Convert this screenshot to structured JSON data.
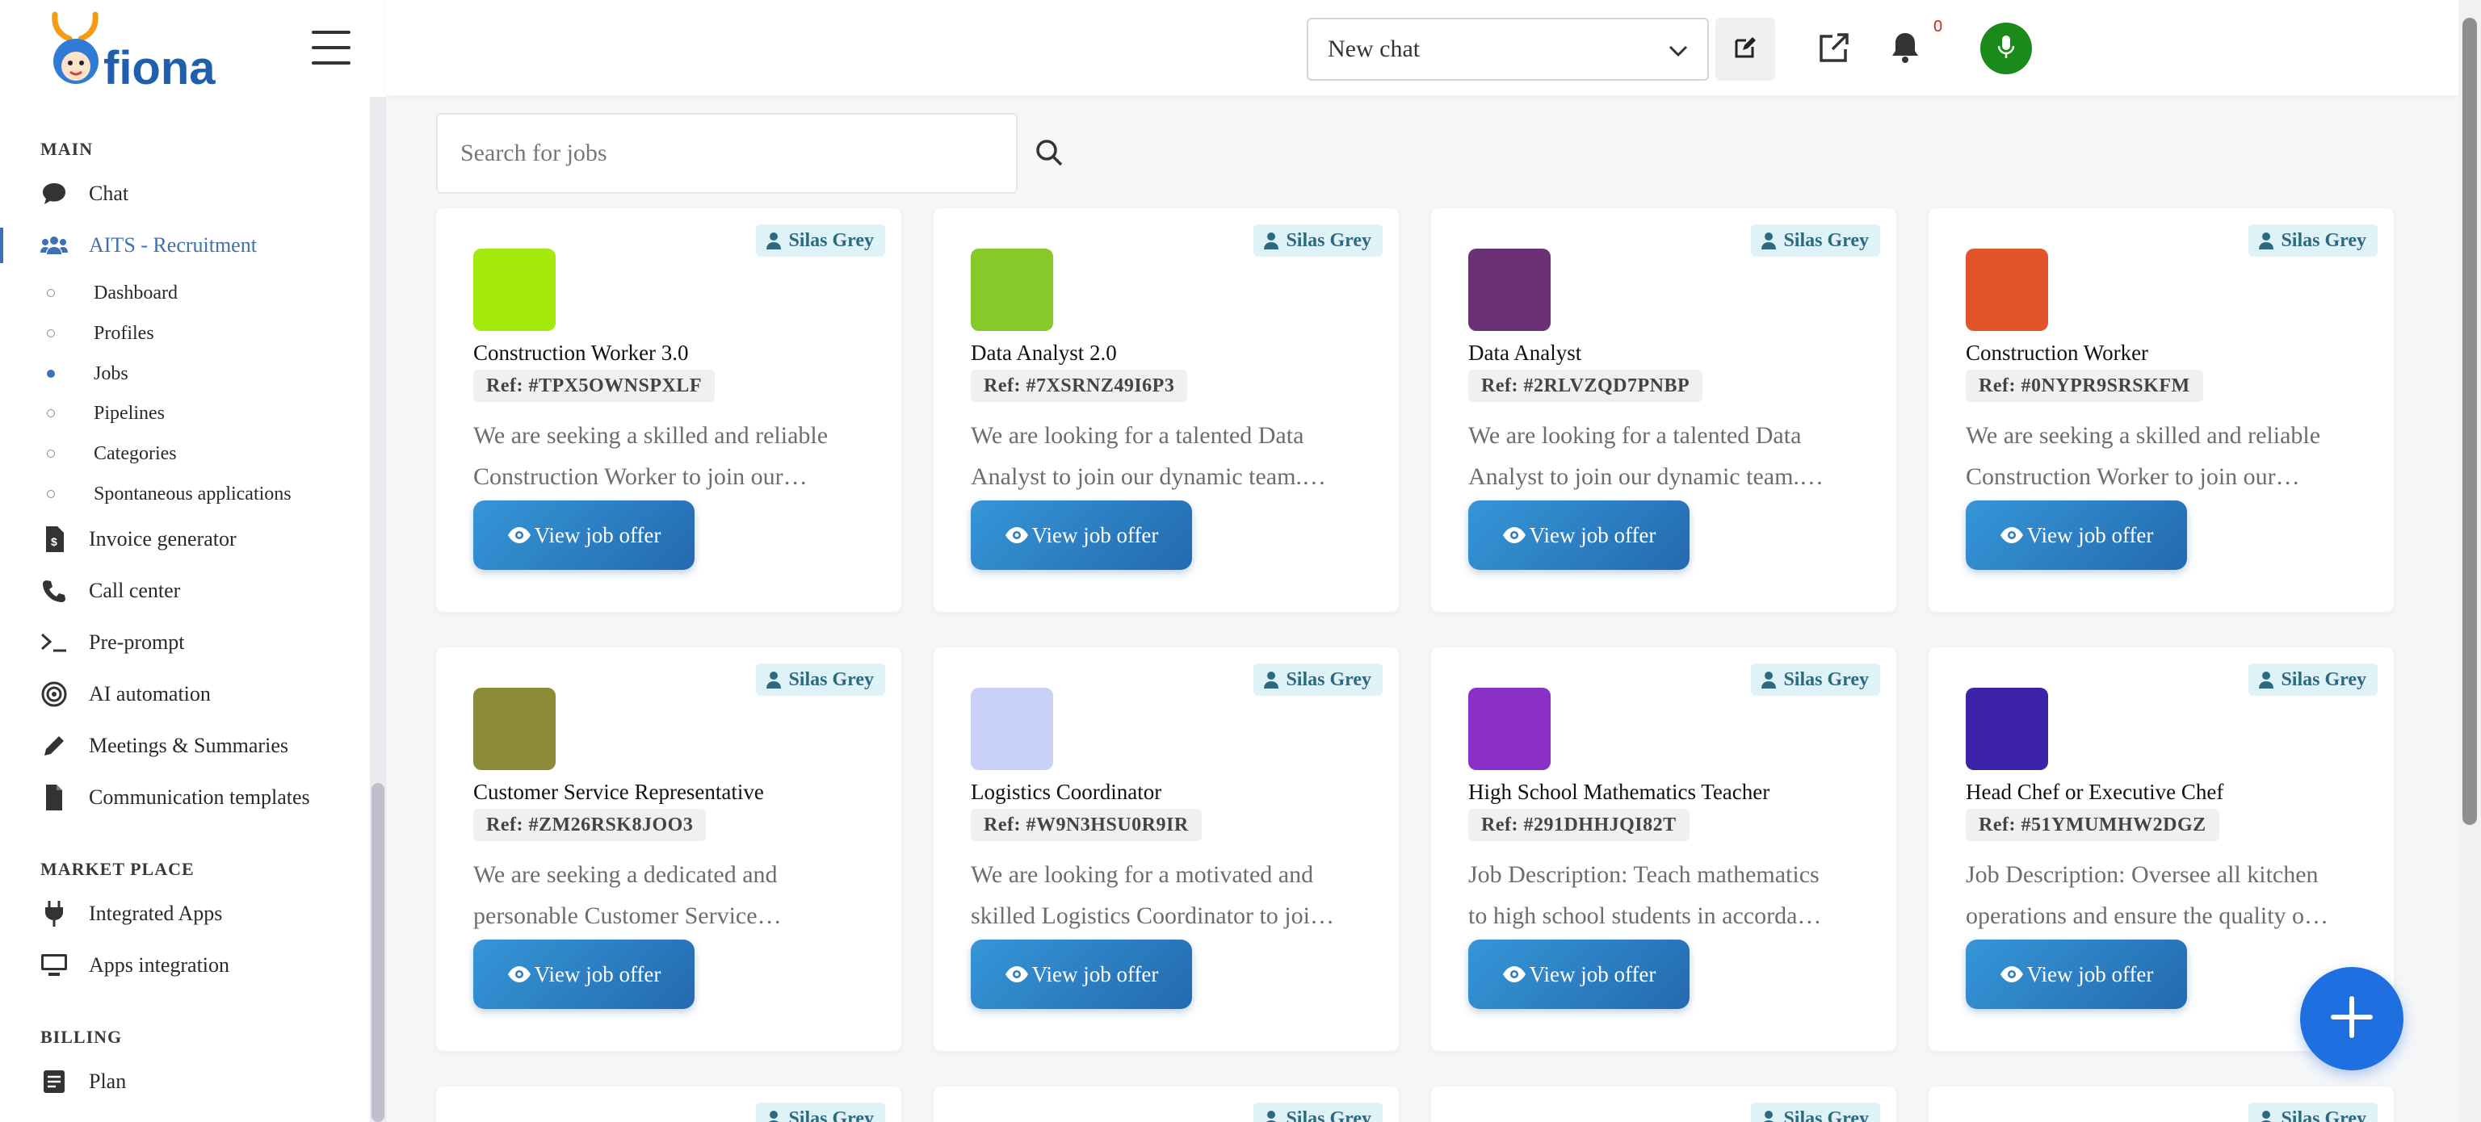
{
  "app": {
    "logo_text": "fiona"
  },
  "sidebar": {
    "sections": [
      {
        "label": "MAIN"
      },
      {
        "label": "MARKET PLACE"
      },
      {
        "label": "BILLING"
      }
    ],
    "items": {
      "chat": "Chat",
      "aits": "AITS - Recruitment",
      "invoice": "Invoice generator",
      "callcenter": "Call center",
      "preprompt": "Pre-prompt",
      "automation": "AI automation",
      "meetings": "Meetings & Summaries",
      "templates": "Communication templates",
      "integrated": "Integrated Apps",
      "appsint": "Apps integration",
      "plan": "Plan"
    },
    "subitems": {
      "dashboard": "Dashboard",
      "profiles": "Profiles",
      "jobs": "Jobs",
      "pipelines": "Pipelines",
      "categories": "Categories",
      "spontaneous": "Spontaneous applications"
    }
  },
  "topbar": {
    "chat_select": "New chat",
    "notification_count": "0"
  },
  "search": {
    "placeholder": "Search for jobs"
  },
  "jobs": [
    {
      "owner": "Silas Grey",
      "color": "#a3ea0c",
      "title": "Construction Worker 3.0",
      "ref": "Ref: #TPX5OWNSPXLF",
      "desc1": "We are seeking a skilled and reliable",
      "desc2": "Construction Worker to join our…",
      "button": "View job offer"
    },
    {
      "owner": "Silas Grey",
      "color": "#86c928",
      "title": "Data Analyst 2.0",
      "ref": "Ref: #7XSRNZ49I6P3",
      "desc1": "We are looking for a talented Data",
      "desc2": "Analyst to join our dynamic team.…",
      "button": "View job offer"
    },
    {
      "owner": "Silas Grey",
      "color": "#6a3274",
      "title": "Data Analyst",
      "ref": "Ref: #2RLVZQD7PNBP",
      "desc1": "We are looking for a talented Data",
      "desc2": "Analyst to join our dynamic team.…",
      "button": "View job offer"
    },
    {
      "owner": "Silas Grey",
      "color": "#e2552a",
      "title": "Construction Worker",
      "ref": "Ref: #0NYPR9SRSKFM",
      "desc1": "We are seeking a skilled and reliable",
      "desc2": "Construction Worker to join our…",
      "button": "View job offer"
    },
    {
      "owner": "Silas Grey",
      "color": "#8b8b38",
      "title": "Customer Service Representative",
      "ref": "Ref: #ZM26RSK8JOO3",
      "desc1": "We are seeking a dedicated and",
      "desc2": "personable Customer Service…",
      "button": "View job offer"
    },
    {
      "owner": "Silas Grey",
      "color": "#cad1f7",
      "title": "Logistics Coordinator",
      "ref": "Ref: #W9N3HSU0R9IR",
      "desc1": "We are looking for a motivated and",
      "desc2": "skilled Logistics Coordinator to joi…",
      "button": "View job offer"
    },
    {
      "owner": "Silas Grey",
      "color": "#8a2fc8",
      "title": "High School Mathematics Teacher",
      "ref": "Ref: #291DHHJQI82T",
      "desc1": "Job Description: Teach mathematics",
      "desc2": "to high school students in accorda…",
      "button": "View job offer"
    },
    {
      "owner": "Silas Grey",
      "color": "#3b22a8",
      "title": "Head Chef or Executive Chef",
      "ref": "Ref: #51YMUMHW2DGZ",
      "desc1": "Job Description: Oversee all kitchen",
      "desc2": "operations and ensure the quality o…",
      "button": "View job offer"
    },
    {
      "owner": "Silas Grey"
    },
    {
      "owner": "Silas Grey"
    },
    {
      "owner": "Silas Grey"
    },
    {
      "owner": "Silas Grey"
    }
  ],
  "colors": {
    "accent": "#3f6fb5",
    "button": "#2d86c8",
    "fab": "#1f6fe0",
    "mic": "#1a8a1a"
  }
}
